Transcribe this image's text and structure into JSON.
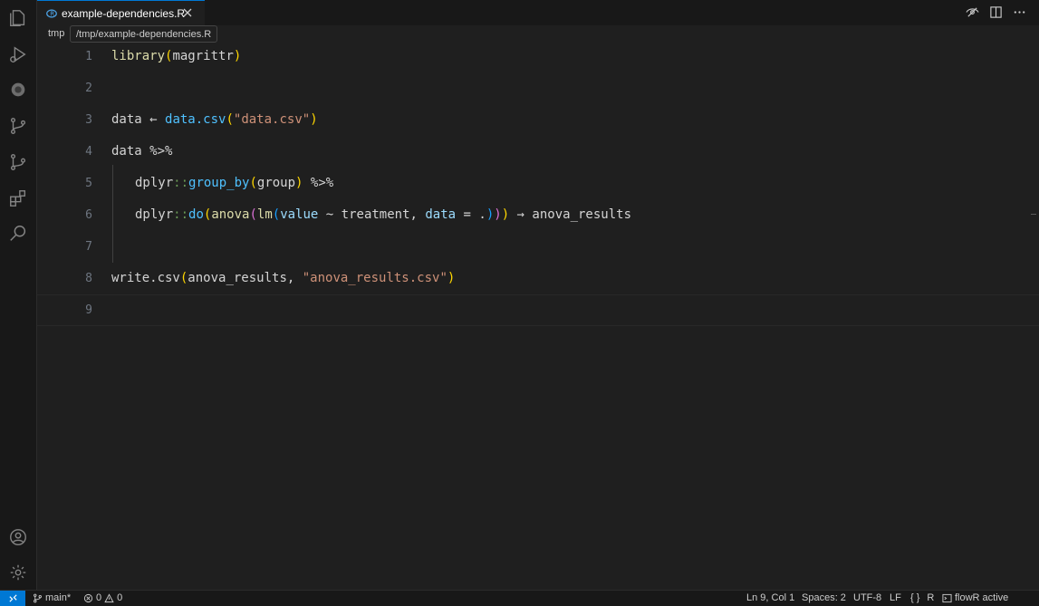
{
  "tab": {
    "label": "example-dependencies.R"
  },
  "breadcrumb": {
    "folder": "tmp",
    "tooltip": "/tmp/example-dependencies.R"
  },
  "editor": {
    "line_numbers": [
      "1",
      "2",
      "3",
      "4",
      "5",
      "6",
      "7",
      "8",
      "9"
    ],
    "code": {
      "l1": {
        "fn": "library",
        "open": "(",
        "arg": "magrittr",
        "close": ")"
      },
      "l3": {
        "var": "data",
        "arrow": " ← ",
        "fn": "data.csv",
        "open": "(",
        "str": "\"data.csv\"",
        "close": ")"
      },
      "l4": {
        "text": "data %>%"
      },
      "l5": {
        "pkg": "dplyr",
        "sep": "::",
        "fn": "group_by",
        "open": "(",
        "arg": "group",
        "close": ")",
        "pipe": " %>%"
      },
      "l6": {
        "pkg": "dplyr",
        "sep": "::",
        "fn": "do",
        "o1": "(",
        "f2": "anova",
        "o2": "(",
        "f3": "lm",
        "o3": "(",
        "a1": "value",
        "tilde": " ~ ",
        "a2": "treatment, ",
        "kw": "data",
        "eq": " = .",
        "c3": ")",
        "c2": ")",
        "c1": ")",
        "arrow": " → ",
        "res": "anova_results"
      },
      "l8": {
        "fn": "write.csv",
        "open": "(",
        "arg": "anova_results, ",
        "str": "\"anova_results.csv\"",
        "close": ")"
      }
    }
  },
  "status": {
    "branch": "main*",
    "errors": "0",
    "warnings": "0",
    "position": "Ln 9, Col 1",
    "spaces": "Spaces: 2",
    "encoding": "UTF-8",
    "eol": "LF",
    "braces": "{ }",
    "language": "R",
    "flowr": "flowR active"
  },
  "colors": {
    "accent": "#0078d4",
    "background": "#1f1f1f"
  },
  "icons": [
    "explorer-icon",
    "run-debug-icon",
    "extension-r-icon",
    "source-control-icon",
    "git-graph-icon",
    "extensions-icon",
    "search-icon",
    "account-icon",
    "settings-gear-icon",
    "remote-icon",
    "close-icon",
    "hide-icon",
    "split-editor-icon",
    "more-actions-icon"
  ]
}
